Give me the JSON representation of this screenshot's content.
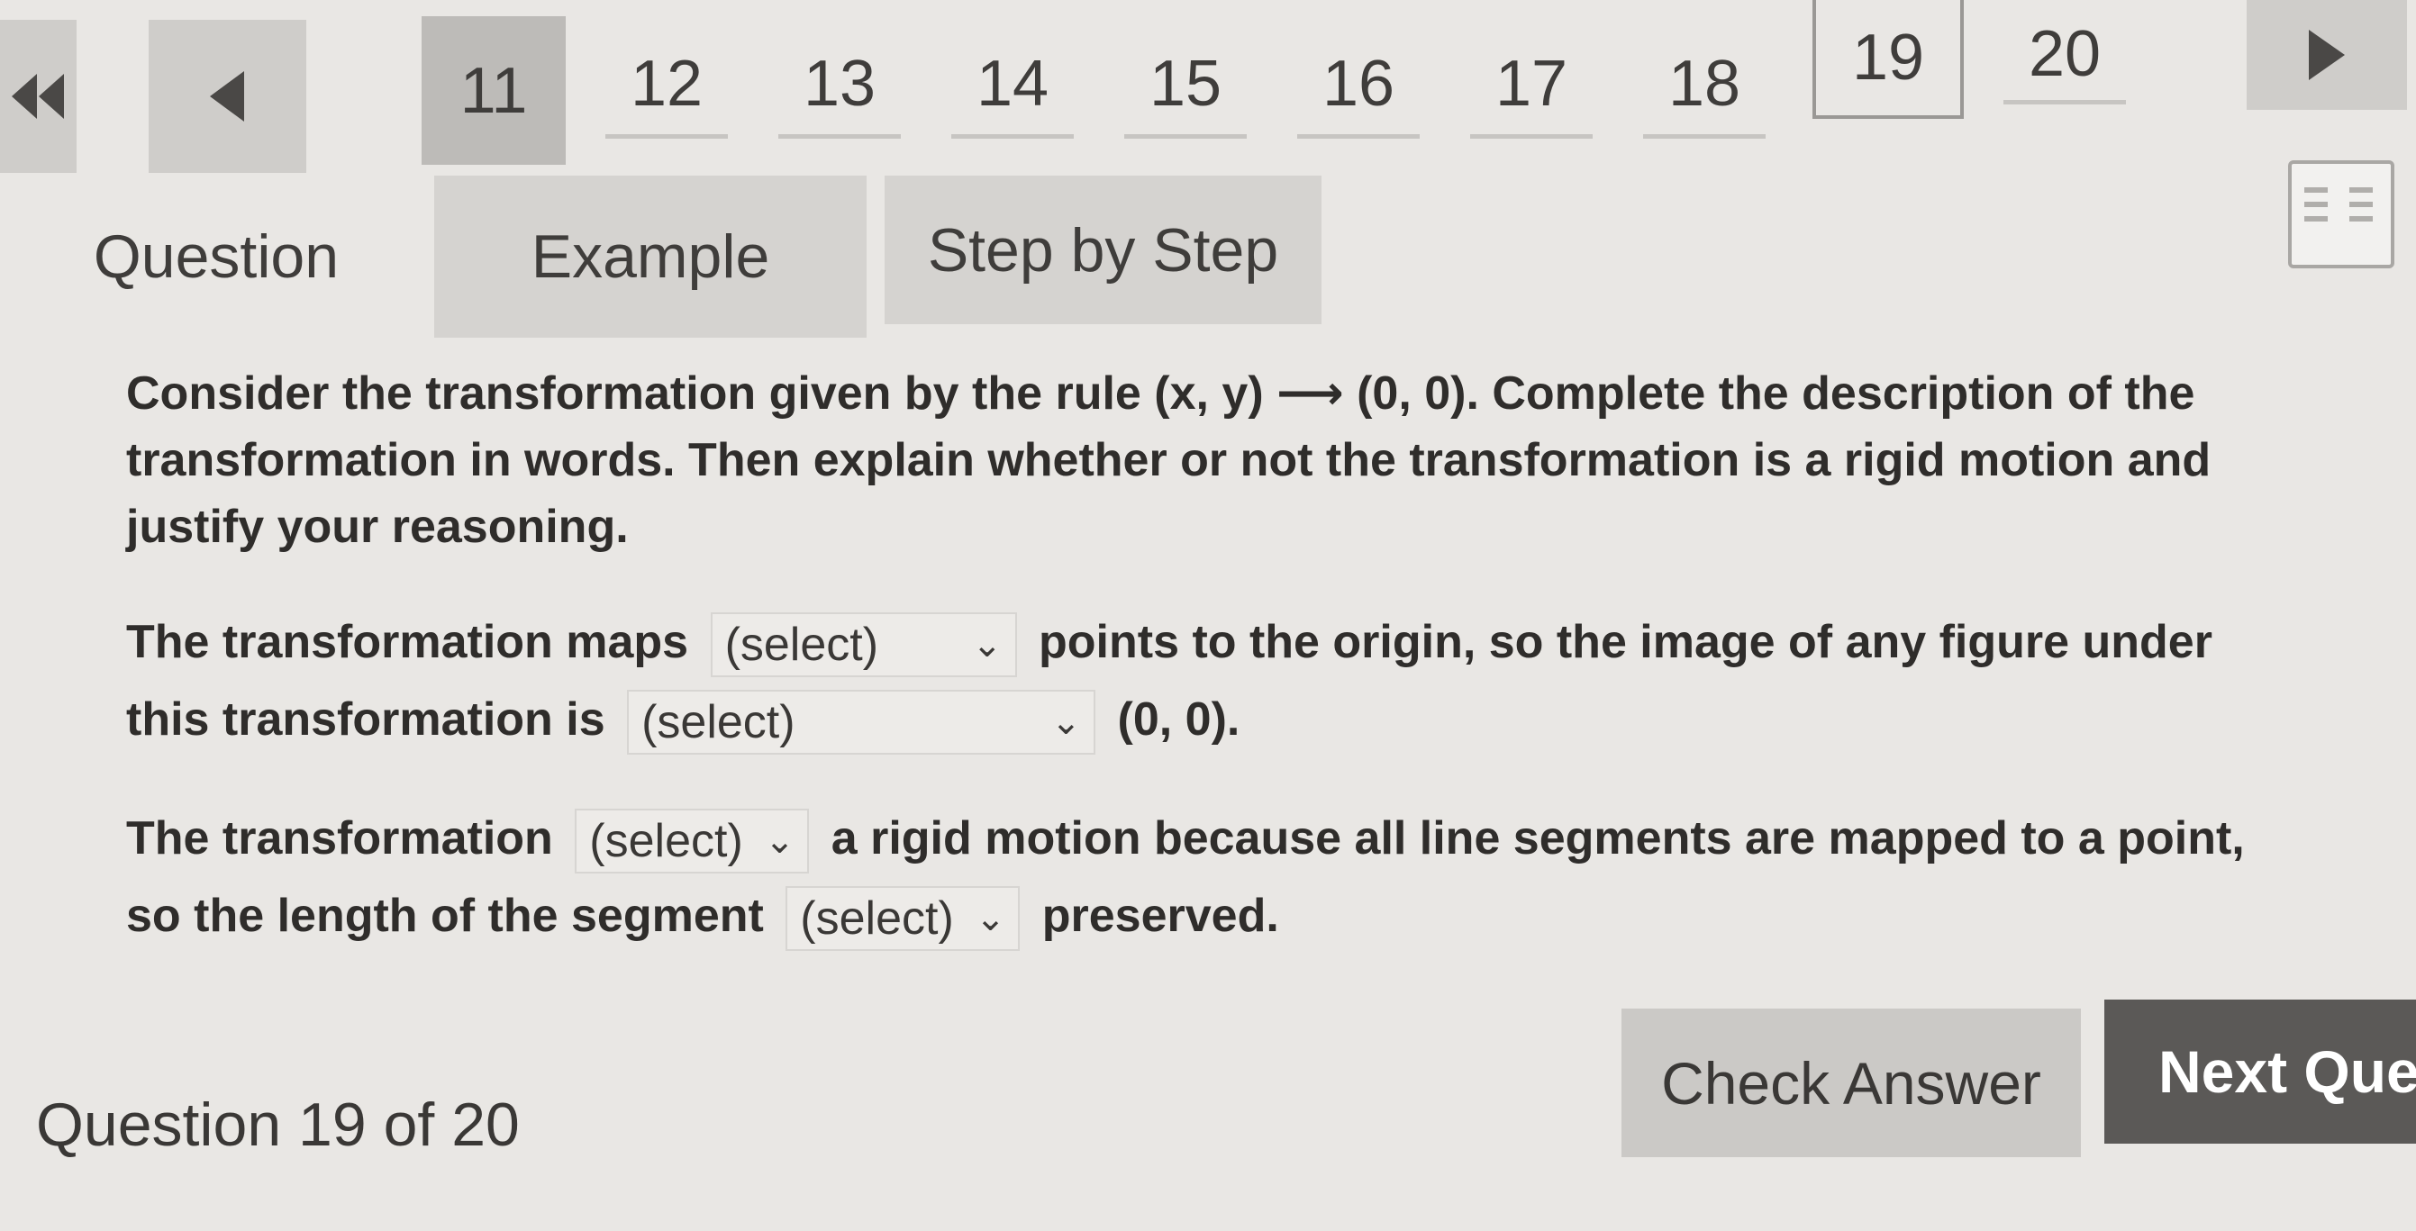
{
  "nav": {
    "first_icon": "double-left-arrow-icon",
    "prev_icon": "left-arrow-icon",
    "next_icon": "right-arrow-icon",
    "questions": [
      "11",
      "12",
      "13",
      "14",
      "15",
      "16",
      "17",
      "18",
      "19",
      "20"
    ],
    "current": "11"
  },
  "tabs": {
    "question": "Question",
    "example": "Example",
    "step_by_step": "Step by Step"
  },
  "prompt": "Consider the transformation given by the rule (x, y) ⟶ (0, 0). Complete the description of the transformation in words. Then explain whether or not the transformation is a rigid motion and justify your reasoning.",
  "sentence1": {
    "a": "The transformation maps",
    "select1": "(select)",
    "b": "points to the origin, so the image of any figure under this transformation is",
    "select2": "(select)",
    "c": "(0, 0)."
  },
  "sentence2": {
    "a": "The transformation",
    "select1": "(select)",
    "b": "a rigid motion because all line segments are mapped to a point, so the length of the segment",
    "select2": "(select)",
    "c": "preserved."
  },
  "footer": {
    "progress": "Question 19 of 20",
    "check": "Check Answer",
    "next": "Next Que"
  },
  "colors": {
    "background": "#e9e7e4",
    "tab_inactive": "#d5d3d0",
    "next_button": "#5b5957"
  }
}
